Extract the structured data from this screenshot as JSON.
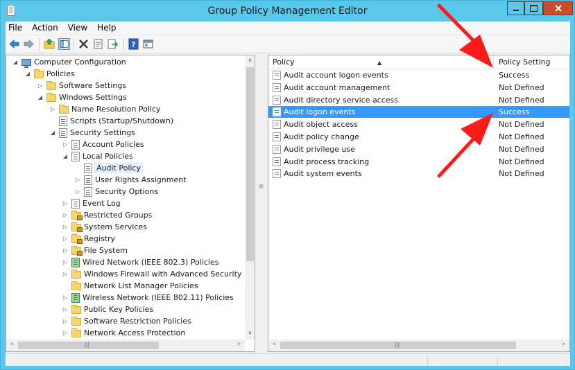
{
  "window": {
    "title": "Group Policy Management Editor",
    "accent_color": "#5ac8ea",
    "close_color": "#c7502b"
  },
  "menu": {
    "items": [
      "File",
      "Action",
      "View",
      "Help"
    ]
  },
  "toolbar": {
    "icons": [
      "back-arrow-icon",
      "forward-arrow-icon",
      "up-folder-icon",
      "show-tree-icon",
      "delete-icon",
      "properties-icon",
      "export-list-icon",
      "help-icon",
      "view-icon"
    ]
  },
  "tree": {
    "items": [
      {
        "label": "Computer Configuration",
        "expanded": true,
        "icon": "computer-icon"
      },
      {
        "label": "Policies",
        "expanded": true,
        "icon": "folder-icon"
      },
      {
        "label": "Software Settings",
        "expanded": false,
        "icon": "folder-icon"
      },
      {
        "label": "Windows Settings",
        "expanded": true,
        "icon": "folder-icon"
      },
      {
        "label": "Name Resolution Policy",
        "expanded": false,
        "icon": "folder-icon"
      },
      {
        "label": "Scripts (Startup/Shutdown)",
        "expanded": false,
        "icon": "document-icon"
      },
      {
        "label": "Security Settings",
        "expanded": true,
        "icon": "security-settings-icon"
      },
      {
        "label": "Account Policies",
        "expanded": false,
        "icon": "document-icon"
      },
      {
        "label": "Local Policies",
        "expanded": true,
        "icon": "document-icon"
      },
      {
        "label": "Audit Policy",
        "expanded": false,
        "icon": "document-icon",
        "selected": true
      },
      {
        "label": "User Rights Assignment",
        "expanded": false,
        "icon": "document-icon"
      },
      {
        "label": "Security Options",
        "expanded": false,
        "icon": "document-icon"
      },
      {
        "label": "Event Log",
        "expanded": false,
        "icon": "document-icon"
      },
      {
        "label": "Restricted Groups",
        "expanded": false,
        "icon": "locked-folder-icon"
      },
      {
        "label": "System Services",
        "expanded": false,
        "icon": "locked-folder-icon"
      },
      {
        "label": "Registry",
        "expanded": false,
        "icon": "locked-folder-icon"
      },
      {
        "label": "File System",
        "expanded": false,
        "icon": "locked-folder-icon"
      },
      {
        "label": "Wired Network (IEEE 802.3) Policies",
        "expanded": false,
        "icon": "network-icon"
      },
      {
        "label": "Windows Firewall with Advanced Security",
        "expanded": false,
        "icon": "folder-icon"
      },
      {
        "label": "Network List Manager Policies",
        "expanded": false,
        "icon": "folder-icon"
      },
      {
        "label": "Wireless Network (IEEE 802.11) Policies",
        "expanded": false,
        "icon": "network-icon"
      },
      {
        "label": "Public Key Policies",
        "expanded": false,
        "icon": "folder-icon"
      },
      {
        "label": "Software Restriction Policies",
        "expanded": false,
        "icon": "folder-icon"
      },
      {
        "label": "Network Access Protection",
        "expanded": false,
        "icon": "folder-icon"
      }
    ]
  },
  "list": {
    "columns": {
      "policy": "Policy",
      "setting": "Policy Setting"
    },
    "rows": [
      {
        "policy": "Audit account logon events",
        "setting": "Success"
      },
      {
        "policy": "Audit account management",
        "setting": "Not Defined"
      },
      {
        "policy": "Audit directory service access",
        "setting": "Not Defined"
      },
      {
        "policy": "Audit logon events",
        "setting": "Success",
        "selected": true
      },
      {
        "policy": "Audit object access",
        "setting": "Not Defined"
      },
      {
        "policy": "Audit policy change",
        "setting": "Not Defined"
      },
      {
        "policy": "Audit privilege use",
        "setting": "Not Defined"
      },
      {
        "policy": "Audit process tracking",
        "setting": "Not Defined"
      },
      {
        "policy": "Audit system events",
        "setting": "Not Defined"
      }
    ],
    "selection_color": "#3399ff"
  },
  "annotation": {
    "arrow_color": "#ff1a1a"
  }
}
